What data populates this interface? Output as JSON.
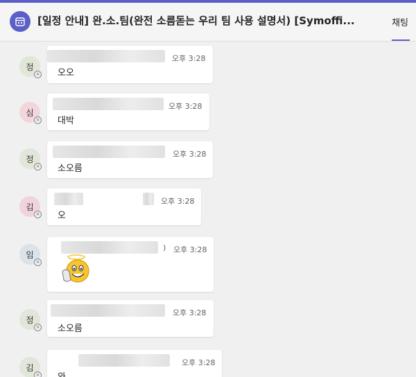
{
  "header": {
    "title": "[일정 안내] 완.소.팀(완전 소름돋는 우리 팀 사용 설명서) [Symoffi...",
    "tab_chat": "채팅",
    "accent_color": "#5b5fc7",
    "icon": "calendar-icon"
  },
  "messages": [
    {
      "avatar": "정",
      "avatar_color": "#e0e6d8",
      "time": "오후 3:28",
      "text": "오오"
    },
    {
      "avatar": "심",
      "avatar_color": "#f3d6dc",
      "time": "오후 3:28",
      "text": "대박"
    },
    {
      "avatar": "정",
      "avatar_color": "#e0e6d8",
      "time": "오후 3:28",
      "text": "소오름"
    },
    {
      "avatar": "김",
      "avatar_color": "#f0d3df",
      "time": "오후 3:28",
      "text": "오"
    },
    {
      "avatar": "임",
      "avatar_color": "#dae3ea",
      "time": "오후 3:28",
      "text": "",
      "sticker": "emoji-sticker",
      "extra_char": ")"
    },
    {
      "avatar": "정",
      "avatar_color": "#e0e6d8",
      "time": "오후 3:28",
      "text": "소오름"
    },
    {
      "avatar": "김",
      "avatar_color": "#e0e6d8",
      "time": "오후 3:28",
      "text": "와"
    }
  ]
}
